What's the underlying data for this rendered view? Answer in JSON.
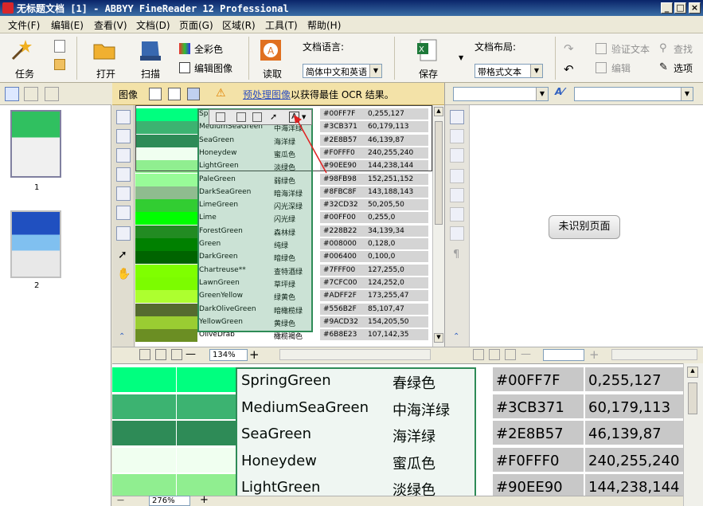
{
  "window": {
    "title": "无标题文档 [1] - ABBYY FineReader 12 Professional"
  },
  "menu": [
    "文件(F)",
    "编辑(E)",
    "查看(V)",
    "文档(D)",
    "页面(G)",
    "区域(R)",
    "工具(T)",
    "帮助(H)"
  ],
  "toolbar": {
    "task": "任务",
    "open": "打开",
    "scan": "扫描",
    "full_color": "全彩色",
    "edit_image": "编辑图像",
    "read": "读取",
    "doc_lang_label": "文档语言:",
    "doc_lang_value": "简体中文和英语",
    "save": "保存",
    "layout_label": "文档布局:",
    "layout_value": "带格式文本",
    "verify": "验证文本",
    "edit": "编辑",
    "find": "查找",
    "options": "选项"
  },
  "pages": [
    {
      "num": "1"
    },
    {
      "num": "2"
    }
  ],
  "image_toolbar": {
    "label": "图像",
    "link": "预处理图像",
    "text": "以获得最佳 OCR 结果。"
  },
  "image_zoom": "134%",
  "zoom_zoom": "276%",
  "text_pane": {
    "unrecognized": "未识别页面"
  },
  "colors": {
    "accent": "#0a246a",
    "selection": "#2e8b57",
    "warning": "#f3e2a8"
  },
  "color_rows": [
    {
      "name": "SpringGreen",
      "cn": "春绿色",
      "hex": "#00FF7F",
      "rgb": "0,255,127",
      "swatch": "#00ff7f"
    },
    {
      "name": "MediumSeaGreen",
      "cn": "中海洋绿",
      "hex": "#3CB371",
      "rgb": "60,179,113",
      "swatch": "#3cb371"
    },
    {
      "name": "SeaGreen",
      "cn": "海洋绿",
      "hex": "#2E8B57",
      "rgb": "46,139,87",
      "swatch": "#2e8b57"
    },
    {
      "name": "Honeydew",
      "cn": "蜜瓜色",
      "hex": "#F0FFF0",
      "rgb": "240,255,240",
      "swatch": "#f0fff0"
    },
    {
      "name": "LightGreen",
      "cn": "淡绿色",
      "hex": "#90EE90",
      "rgb": "144,238,144",
      "swatch": "#90ee90"
    },
    {
      "name": "PaleGreen",
      "cn": "弱绿色",
      "hex": "#98FB98",
      "rgb": "152,251,152",
      "swatch": "#98fb98"
    },
    {
      "name": "DarkSeaGreen",
      "cn": "暗海洋绿",
      "hex": "#8FBC8F",
      "rgb": "143,188,143",
      "swatch": "#8fbc8f"
    },
    {
      "name": "LimeGreen",
      "cn": "闪光深绿",
      "hex": "#32CD32",
      "rgb": "50,205,50",
      "swatch": "#32cd32"
    },
    {
      "name": "Lime",
      "cn": "闪光绿",
      "hex": "#00FF00",
      "rgb": "0,255,0",
      "swatch": "#00ff00"
    },
    {
      "name": "ForestGreen",
      "cn": "森林绿",
      "hex": "#228B22",
      "rgb": "34,139,34",
      "swatch": "#228b22"
    },
    {
      "name": "Green",
      "cn": "纯绿",
      "hex": "#008000",
      "rgb": "0,128,0",
      "swatch": "#008000"
    },
    {
      "name": "DarkGreen",
      "cn": "暗绿色",
      "hex": "#006400",
      "rgb": "0,100,0",
      "swatch": "#006400"
    },
    {
      "name": "Chartreuse**",
      "cn": "查特酒绿",
      "hex": "#7FFF00",
      "rgb": "127,255,0",
      "swatch": "#7fff00"
    },
    {
      "name": "LawnGreen",
      "cn": "草坪绿",
      "hex": "#7CFC00",
      "rgb": "124,252,0",
      "swatch": "#7cfc00"
    },
    {
      "name": "GreenYellow",
      "cn": "绿黄色",
      "hex": "#ADFF2F",
      "rgb": "173,255,47",
      "swatch": "#adff2f"
    },
    {
      "name": "DarkOliveGreen",
      "cn": "暗橄榄绿",
      "hex": "#556B2F",
      "rgb": "85,107,47",
      "swatch": "#556b2f"
    },
    {
      "name": "YellowGreen",
      "cn": "黄绿色",
      "hex": "#9ACD32",
      "rgb": "154,205,50",
      "swatch": "#9acd32"
    },
    {
      "name": "OliveDrab",
      "cn": "橄榄褐色",
      "hex": "#6B8E23",
      "rgb": "107,142,35",
      "swatch": "#6b8e23"
    }
  ],
  "zoom_rows": [
    {
      "name": "SpringGreen",
      "cn": "春绿色",
      "hex": "#00FF7F",
      "rgb": "0,255,127",
      "swatch": "#00ff7f"
    },
    {
      "name": "MediumSeaGreen",
      "cn": "中海洋绿",
      "hex": "#3CB371",
      "rgb": "60,179,113",
      "swatch": "#3cb371"
    },
    {
      "name": "SeaGreen",
      "cn": "海洋绿",
      "hex": "#2E8B57",
      "rgb": "46,139,87",
      "swatch": "#2e8b57"
    },
    {
      "name": "Honeydew",
      "cn": "蜜瓜色",
      "hex": "#F0FFF0",
      "rgb": "240,255,240",
      "swatch": "#f0fff0"
    },
    {
      "name": "LightGreen",
      "cn": "淡绿色",
      "hex": "#90EE90",
      "rgb": "144,238,144",
      "swatch": "#90ee90"
    }
  ]
}
